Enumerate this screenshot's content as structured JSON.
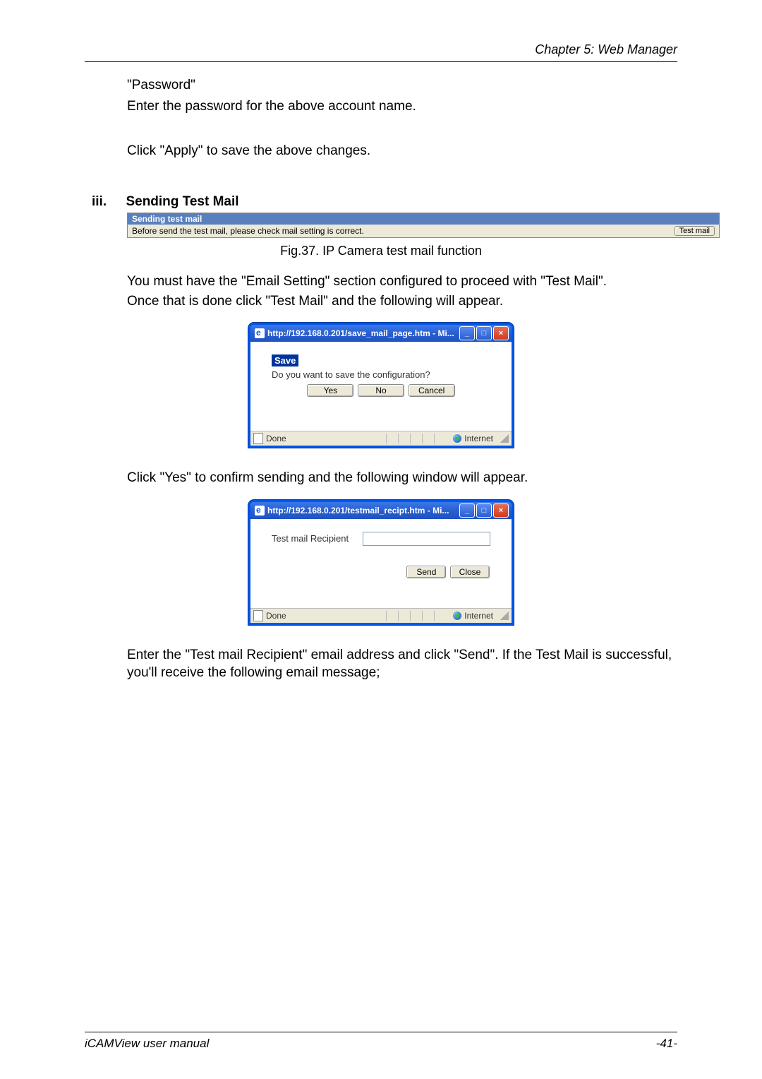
{
  "header": "Chapter 5: Web Manager",
  "para_password_title": "\"Password\"",
  "para_password_text": "Enter the password for the above account name.",
  "para_apply": "Click \"Apply\" to save the above changes.",
  "section": {
    "label": "iii.",
    "title": "Sending Test Mail"
  },
  "testmail_bar": {
    "head": "Sending test mail",
    "body": "Before send the test mail, please check mail setting is correct.",
    "button": "Test mail"
  },
  "fig_caption": "Fig.37.  IP Camera test mail function",
  "para_config_1": "You must have the \"Email Setting\" section configured to proceed with \"Test Mail\".",
  "para_config_2": "Once that is done click \"Test Mail\" and the following will appear.",
  "win1": {
    "title": "http://192.168.0.201/save_mail_page.htm - Mi...",
    "content_title": "Save",
    "prompt": "Do you want to save the configuration?",
    "yes": "Yes",
    "no": "No",
    "cancel": "Cancel",
    "status_done": "Done",
    "status_zone": "Internet"
  },
  "para_click_yes": "Click \"Yes\" to confirm sending and the following window will appear.",
  "win2": {
    "title": "http://192.168.0.201/testmail_recipt.htm - Mi...",
    "label": "Test mail Recipient",
    "send": "Send",
    "close": "Close",
    "status_done": "Done",
    "status_zone": "Internet"
  },
  "para_enter_recipient": "Enter the \"Test mail Recipient\" email address and click \"Send\".    If the Test Mail is successful, you'll receive the following email message;",
  "footer": {
    "left": "iCAMView  user  manual",
    "right": "-41-"
  },
  "win_controls": {
    "min": "_",
    "max": "□",
    "close": "×"
  }
}
